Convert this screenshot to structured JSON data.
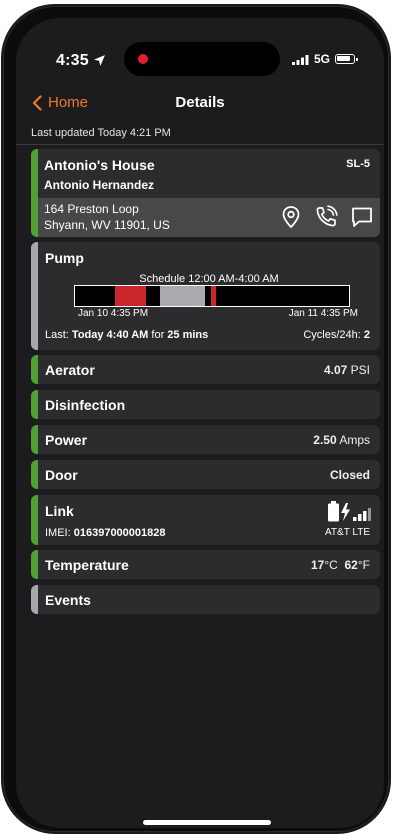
{
  "status_bar": {
    "time": "4:35",
    "network": "5G"
  },
  "nav": {
    "back_label": "Home",
    "title": "Details"
  },
  "last_updated": "Last updated Today 4:21 PM",
  "site": {
    "name": "Antonio's House",
    "id": "SL-5",
    "owner": "Antonio Hernandez",
    "address_line1": "164 Preston Loop",
    "address_line2": "Shyann, WV 11901, US"
  },
  "pump": {
    "title": "Pump",
    "schedule": "Schedule 12:00 AM-4:00 AM",
    "start_date": "Jan 10 4:35 PM",
    "end_date": "Jan 11 4:35 PM",
    "last_prefix": "Last:",
    "last_time": "Today 4:40 AM",
    "last_for": "for",
    "last_duration": "25 mins",
    "cycles_label": "Cycles/24h:",
    "cycles_value": "2",
    "timeline": [
      {
        "kind": "run",
        "start": 0.146,
        "end": 0.258,
        "color": "#c8262c"
      },
      {
        "kind": "schedule",
        "start": 0.31,
        "end": 0.476,
        "color": "#a9a9ae"
      },
      {
        "kind": "run",
        "start": 0.498,
        "end": 0.514,
        "color": "#c8262c"
      }
    ]
  },
  "rows": {
    "aerator": {
      "title": "Aerator",
      "value": "4.07",
      "unit": "PSI"
    },
    "disinfection": {
      "title": "Disinfection"
    },
    "power": {
      "title": "Power",
      "value": "2.50",
      "unit": "Amps"
    },
    "door": {
      "title": "Door",
      "value": "Closed"
    },
    "link": {
      "title": "Link",
      "imei_label": "IMEI:",
      "imei": "016397000001828",
      "carrier": "AT&T LTE"
    },
    "temperature": {
      "title": "Temperature",
      "celsius": "17",
      "celsius_unit": "°C",
      "fahrenheit": "62",
      "fahrenheit_unit": "°F"
    },
    "events": {
      "title": "Events"
    }
  },
  "colors": {
    "accent": "#ef7a2a",
    "status_ok": "#52a035",
    "status_neutral": "#a8a8ac",
    "run": "#c8262c"
  },
  "icons": [
    "location-arrow-icon",
    "signal-icon",
    "battery-icon",
    "chevron-left-icon",
    "map-pin-icon",
    "phone-icon",
    "chat-bubble-icon",
    "battery-charging-icon",
    "cell-signal-icon"
  ]
}
